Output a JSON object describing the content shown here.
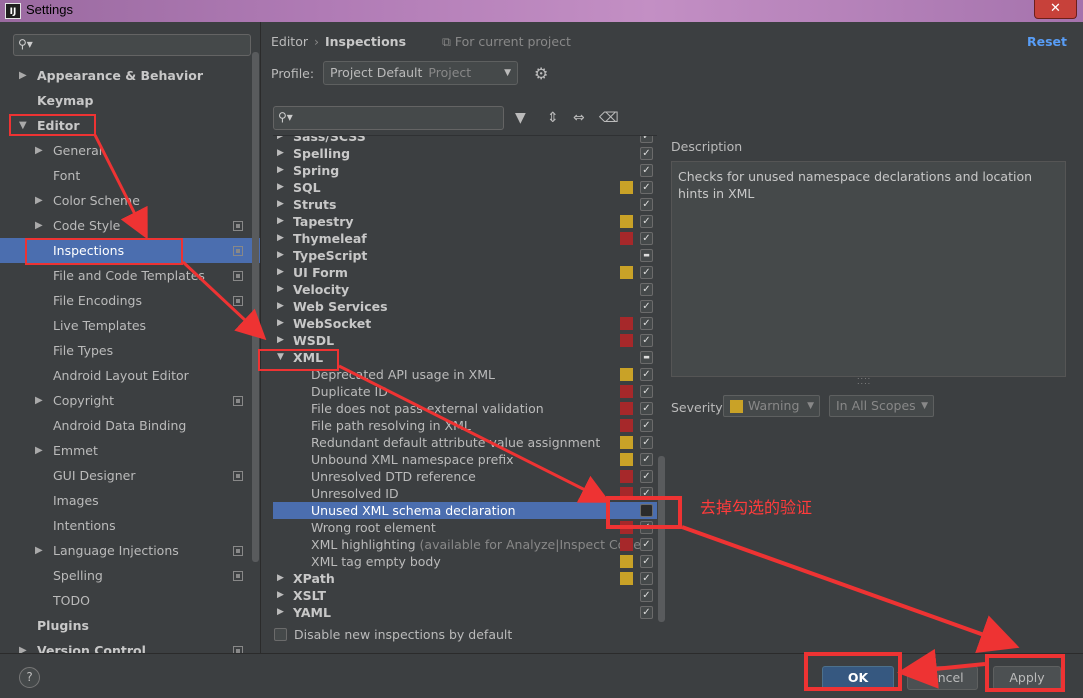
{
  "window": {
    "title": "Settings",
    "app_icon": "IJ",
    "close_glyph": "✕"
  },
  "colors": {
    "accent": "#4b6eaf",
    "warning": "#c9a227",
    "error": "#a6282a",
    "annotation": "#ee3333",
    "link": "#589df6"
  },
  "sidebar": {
    "search_placeholder": "",
    "items": [
      {
        "label": "Appearance & Behavior",
        "level": 0,
        "arrow": "▶",
        "bold": true
      },
      {
        "label": "Keymap",
        "level": 0,
        "arrow": "",
        "bold": true
      },
      {
        "label": "Editor",
        "level": 0,
        "arrow": "▼",
        "bold": true
      },
      {
        "label": "General",
        "level": 1,
        "arrow": "▶"
      },
      {
        "label": "Font",
        "level": 1,
        "arrow": ""
      },
      {
        "label": "Color Scheme",
        "level": 1,
        "arrow": "▶"
      },
      {
        "label": "Code Style",
        "level": 1,
        "arrow": "▶",
        "copy": true
      },
      {
        "label": "Inspections",
        "level": 1,
        "arrow": "",
        "copy": true,
        "selected": true
      },
      {
        "label": "File and Code Templates",
        "level": 1,
        "arrow": "",
        "copy": true
      },
      {
        "label": "File Encodings",
        "level": 1,
        "arrow": "",
        "copy": true
      },
      {
        "label": "Live Templates",
        "level": 1,
        "arrow": ""
      },
      {
        "label": "File Types",
        "level": 1,
        "arrow": ""
      },
      {
        "label": "Android Layout Editor",
        "level": 1,
        "arrow": ""
      },
      {
        "label": "Copyright",
        "level": 1,
        "arrow": "▶",
        "copy": true
      },
      {
        "label": "Android Data Binding",
        "level": 1,
        "arrow": ""
      },
      {
        "label": "Emmet",
        "level": 1,
        "arrow": "▶"
      },
      {
        "label": "GUI Designer",
        "level": 1,
        "arrow": "",
        "copy": true
      },
      {
        "label": "Images",
        "level": 1,
        "arrow": ""
      },
      {
        "label": "Intentions",
        "level": 1,
        "arrow": ""
      },
      {
        "label": "Language Injections",
        "level": 1,
        "arrow": "▶",
        "copy": true
      },
      {
        "label": "Spelling",
        "level": 1,
        "arrow": "",
        "copy": true
      },
      {
        "label": "TODO",
        "level": 1,
        "arrow": ""
      },
      {
        "label": "Plugins",
        "level": 0,
        "arrow": "",
        "bold": true
      },
      {
        "label": "Version Control",
        "level": 0,
        "arrow": "▶",
        "bold": true,
        "copy": true
      }
    ]
  },
  "header": {
    "breadcrumb_parent": "Editor",
    "breadcrumb_sep": "›",
    "breadcrumb_current": "Inspections",
    "scope_note": "For current project",
    "reset_label": "Reset"
  },
  "profile": {
    "label": "Profile:",
    "value": "Project Default",
    "sub": "Project"
  },
  "inspections": {
    "search_placeholder": "",
    "rows": [
      {
        "label": "Sass/SCSS",
        "group": true,
        "expanded": false,
        "sev": "",
        "check": "on"
      },
      {
        "label": "Spelling",
        "group": true,
        "expanded": false,
        "sev": "",
        "check": "on"
      },
      {
        "label": "Spring",
        "group": true,
        "expanded": false,
        "sev": "",
        "check": "on"
      },
      {
        "label": "SQL",
        "group": true,
        "expanded": false,
        "sev": "warning",
        "check": "on"
      },
      {
        "label": "Struts",
        "group": true,
        "expanded": false,
        "sev": "",
        "check": "on"
      },
      {
        "label": "Tapestry",
        "group": true,
        "expanded": false,
        "sev": "warning",
        "check": "on"
      },
      {
        "label": "Thymeleaf",
        "group": true,
        "expanded": false,
        "sev": "error",
        "check": "on"
      },
      {
        "label": "TypeScript",
        "group": true,
        "expanded": false,
        "sev": "",
        "check": "partial"
      },
      {
        "label": "UI Form",
        "group": true,
        "expanded": false,
        "sev": "warning",
        "check": "on"
      },
      {
        "label": "Velocity",
        "group": true,
        "expanded": false,
        "sev": "",
        "check": "on"
      },
      {
        "label": "Web Services",
        "group": true,
        "expanded": false,
        "sev": "",
        "check": "on"
      },
      {
        "label": "WebSocket",
        "group": true,
        "expanded": false,
        "sev": "error",
        "check": "on"
      },
      {
        "label": "WSDL",
        "group": true,
        "expanded": false,
        "sev": "error",
        "check": "on"
      },
      {
        "label": "XML",
        "group": true,
        "expanded": true,
        "sev": "",
        "check": "partial"
      },
      {
        "label": "Deprecated API usage in XML",
        "group": false,
        "sev": "warning",
        "check": "on"
      },
      {
        "label": "Duplicate ID",
        "group": false,
        "sev": "error",
        "check": "on"
      },
      {
        "label": "File does not pass external validation",
        "group": false,
        "sev": "error",
        "check": "on"
      },
      {
        "label": "File path resolving in XML",
        "group": false,
        "sev": "error",
        "check": "on"
      },
      {
        "label": "Redundant default attribute value assignment",
        "group": false,
        "sev": "warning",
        "check": "on"
      },
      {
        "label": "Unbound XML namespace prefix",
        "group": false,
        "sev": "warning",
        "check": "on"
      },
      {
        "label": "Unresolved DTD reference",
        "group": false,
        "sev": "error",
        "check": "on"
      },
      {
        "label": "Unresolved ID",
        "group": false,
        "sev": "error",
        "check": "on"
      },
      {
        "label": "Unused XML schema declaration",
        "group": false,
        "sev": "",
        "check": "off",
        "selected": true
      },
      {
        "label": "Wrong root element",
        "group": false,
        "sev": "error",
        "check": "on"
      },
      {
        "label": "XML highlighting",
        "suffix": " (available for Analyze|Inspect Code)",
        "group": false,
        "sev": "error",
        "check": "on"
      },
      {
        "label": "XML tag empty body",
        "group": false,
        "sev": "warning",
        "check": "on"
      },
      {
        "label": "XPath",
        "group": true,
        "expanded": false,
        "sev": "warning",
        "check": "on"
      },
      {
        "label": "XSLT",
        "group": true,
        "expanded": false,
        "sev": "",
        "check": "on"
      },
      {
        "label": "YAML",
        "group": true,
        "expanded": false,
        "sev": "",
        "check": "on"
      }
    ],
    "disable_new_label": "Disable new inspections by default"
  },
  "description": {
    "label": "Description",
    "text": "Checks for unused namespace declarations and location hints in XML",
    "grip": "⁚⁚⁚⁚"
  },
  "severity": {
    "label": "Severity:",
    "value": "Warning",
    "scope": "In All Scopes"
  },
  "footer": {
    "help": "?",
    "ok": "OK",
    "cancel": "Cancel",
    "apply": "Apply"
  },
  "annotation": {
    "text": "去掉勾选的验证"
  },
  "icons": {
    "search": "⚲",
    "filter": "▼",
    "expand_all": "⇕",
    "collapse_all": "⇔",
    "eraser": "⌫",
    "gear": "⚙",
    "dropdown": "▼"
  }
}
